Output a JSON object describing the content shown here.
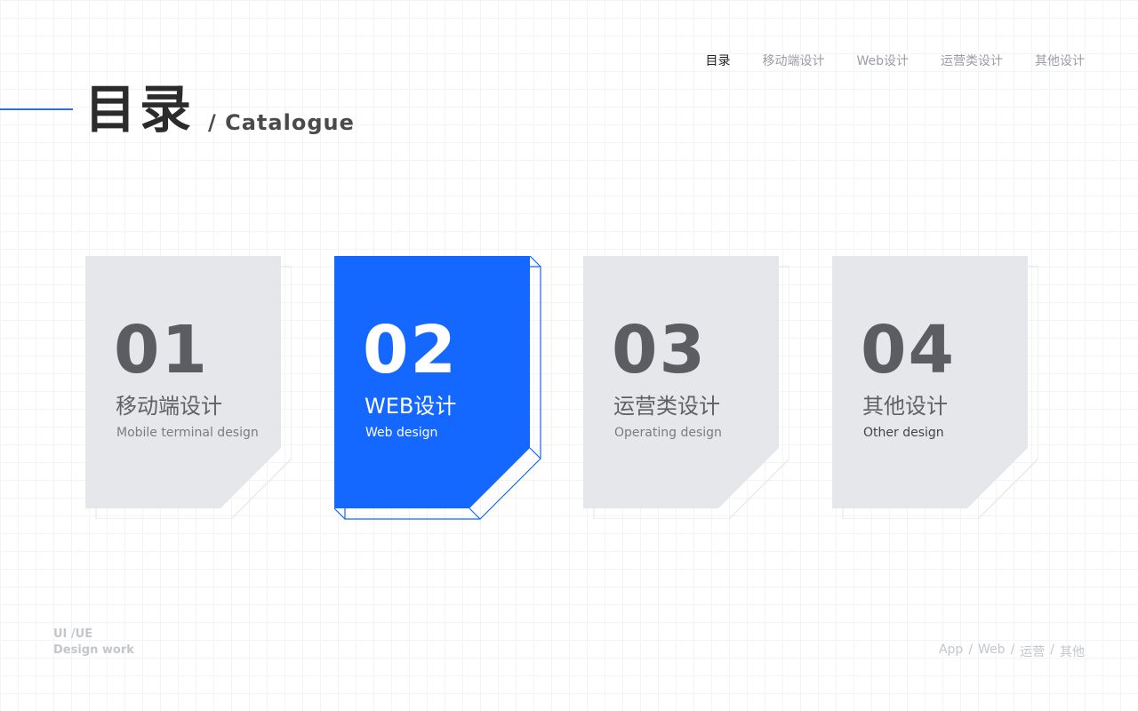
{
  "nav": {
    "items": [
      {
        "label": "目录",
        "active": true
      },
      {
        "label": "移动端设计",
        "active": false
      },
      {
        "label": "Web设计",
        "active": false
      },
      {
        "label": "运营类设计",
        "active": false
      },
      {
        "label": "其他设计",
        "active": false
      }
    ]
  },
  "header": {
    "title_cn": "目录",
    "title_en": "/ Catalogue"
  },
  "colors": {
    "accent": "#1467ff",
    "card_gray": "#e6e7eb",
    "outline_gray": "#e2e3e7"
  },
  "cards": [
    {
      "number": "01",
      "title_cn": "移动端设计",
      "title_en": "Mobile terminal design",
      "active": false
    },
    {
      "number": "02",
      "title_cn": "WEB设计",
      "title_en": "Web design",
      "active": true
    },
    {
      "number": "03",
      "title_cn": "运营类设计",
      "title_en": "Operating design",
      "active": false
    },
    {
      "number": "04",
      "title_cn": "其他设计",
      "title_en": "Other design",
      "active": false
    }
  ],
  "footer": {
    "left_line1": "UI /UE",
    "left_line2": "Design work",
    "links": [
      "App",
      "Web",
      "运营",
      "其他"
    ],
    "separator": "/"
  }
}
